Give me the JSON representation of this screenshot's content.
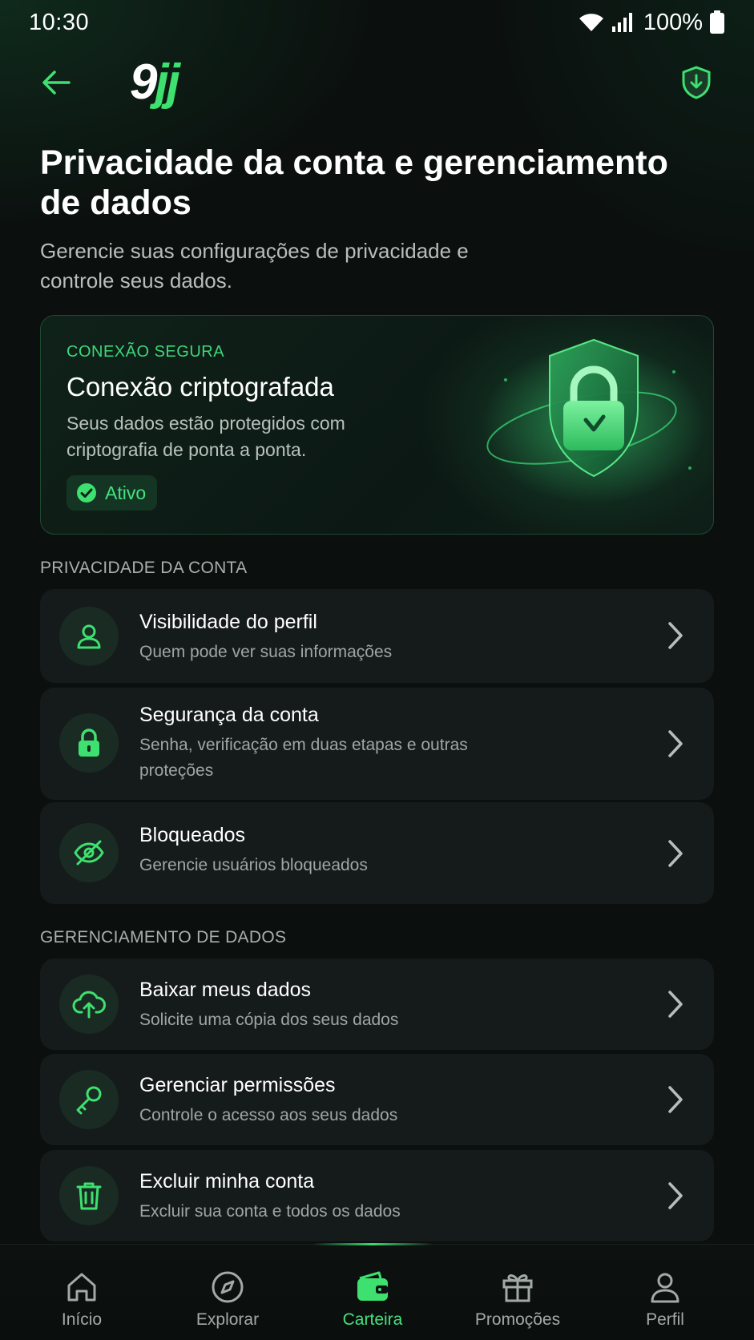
{
  "status_bar": {
    "time": "10:30",
    "battery": "100%"
  },
  "header": {
    "logo_main": "9",
    "logo_accent": "jj"
  },
  "page": {
    "title": "Privacidade da conta e gerenciamento de dados",
    "subtitle": "Gerencie suas configurações de privacidade e controle seus dados."
  },
  "secure_card": {
    "kicker": "CONEXÃO SEGURA",
    "title": "Conexão criptografada",
    "description": "Seus dados estão protegidos com criptografia de ponta a ponta.",
    "badge": "Ativo"
  },
  "sections": {
    "privacy": {
      "label": "PRIVACIDADE DA CONTA",
      "items": [
        {
          "title": "Visibilidade do perfil",
          "subtitle": "Quem pode ver suas informações",
          "icon": "user-icon"
        },
        {
          "title": "Segurança da conta",
          "subtitle": "Senha, verificação em duas etapas e outras proteções",
          "icon": "lock-icon"
        },
        {
          "title": "Bloqueados",
          "subtitle": "Gerencie usuários bloqueados",
          "icon": "eye-off-icon"
        }
      ]
    },
    "data": {
      "label": "GERENCIAMENTO DE DADOS",
      "items": [
        {
          "title": "Baixar meus dados",
          "subtitle": "Solicite uma cópia dos seus dados",
          "icon": "cloud-upload-icon"
        },
        {
          "title": "Gerenciar permissões",
          "subtitle": "Controle o acesso aos seus dados",
          "icon": "key-icon"
        },
        {
          "title": "Excluir minha conta",
          "subtitle": "Excluir sua conta e todos os dados",
          "icon": "trash-icon"
        }
      ]
    }
  },
  "bottom_nav": {
    "items": [
      {
        "label": "Início",
        "icon": "home-icon"
      },
      {
        "label": "Explorar",
        "icon": "compass-icon"
      },
      {
        "label": "Carteira",
        "icon": "wallet-icon",
        "active": true
      },
      {
        "label": "Promoções",
        "icon": "gift-icon"
      },
      {
        "label": "Perfil",
        "icon": "profile-icon"
      }
    ]
  },
  "colors": {
    "accent": "#3ee06f",
    "background": "#0b0f0e",
    "card": "#151b1a"
  }
}
